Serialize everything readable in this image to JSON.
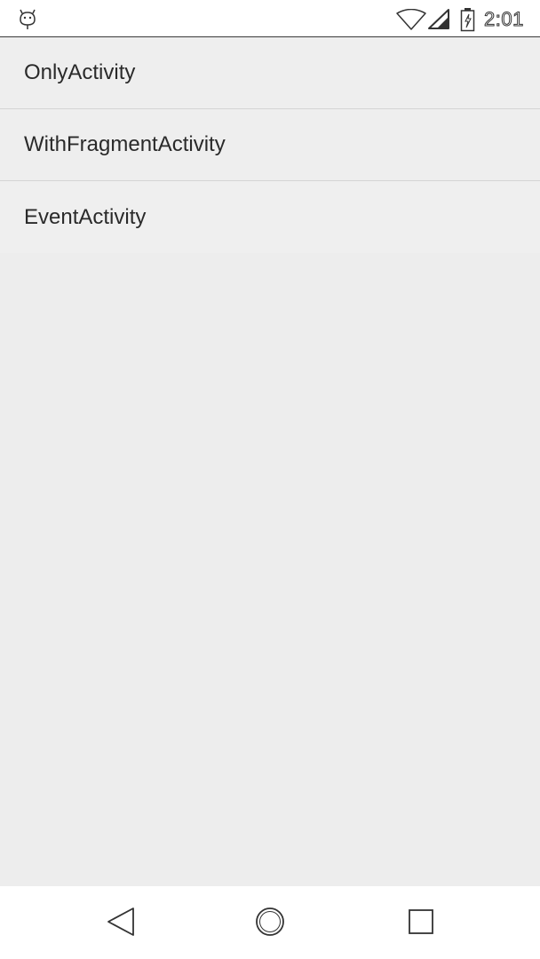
{
  "status_bar": {
    "time": "2:01",
    "icons": [
      "notification-icon",
      "wifi-icon",
      "signal-icon",
      "battery-icon"
    ]
  },
  "list": {
    "items": [
      {
        "label": "OnlyActivity"
      },
      {
        "label": "WithFragmentActivity"
      },
      {
        "label": "EventActivity"
      }
    ]
  },
  "nav_bar": {
    "buttons": [
      "back",
      "home",
      "recents"
    ]
  },
  "colors": {
    "background": "#ededed",
    "bars": "#ffffff",
    "text": "#2a2a2a",
    "divider": "#d4d4d4"
  }
}
